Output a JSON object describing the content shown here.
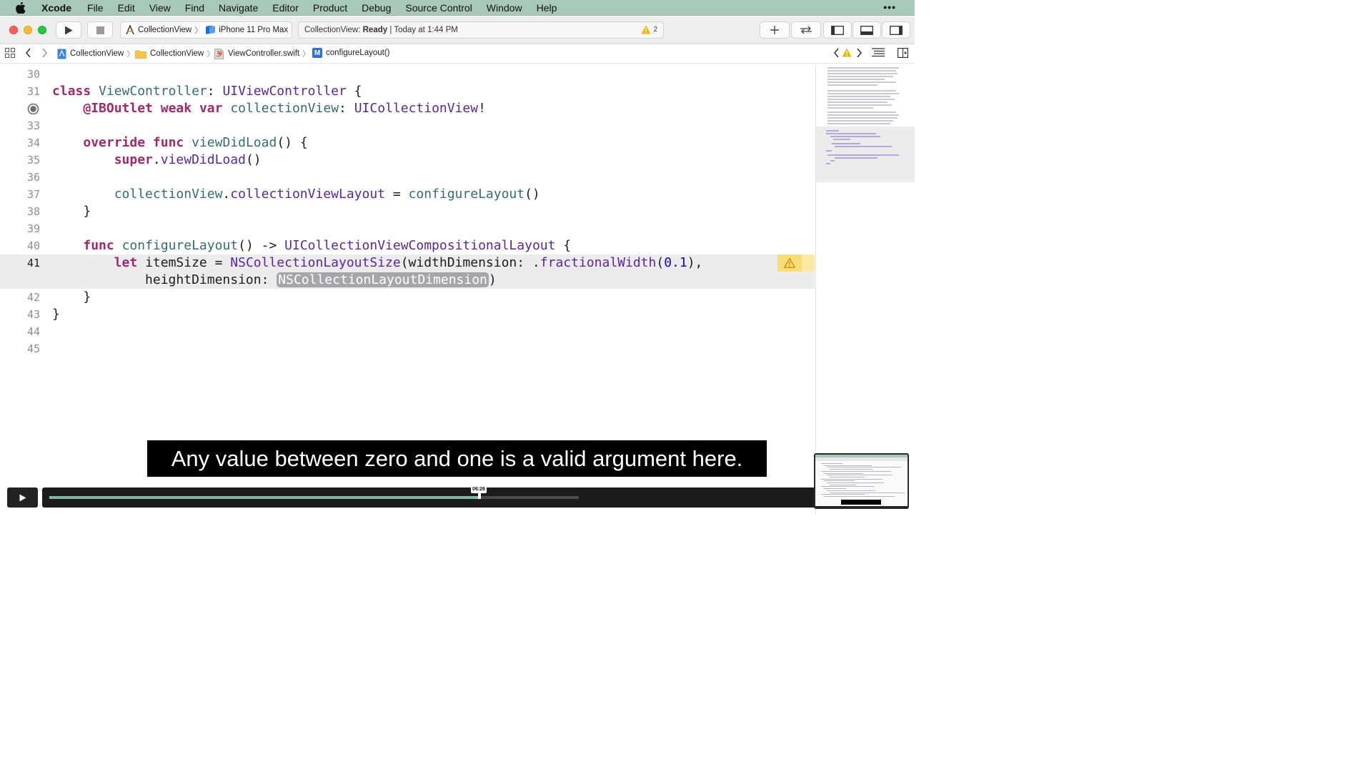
{
  "menubar": {
    "app": "Xcode",
    "items": [
      "File",
      "Edit",
      "View",
      "Find",
      "Navigate",
      "Editor",
      "Product",
      "Debug",
      "Source Control",
      "Window",
      "Help"
    ],
    "more": "•••"
  },
  "toolbar": {
    "scheme": "CollectionView",
    "device": "iPhone 11 Pro Max",
    "status_project": "CollectionView:",
    "status_state": "Ready",
    "status_time": "Today at 1:44 PM",
    "warning_count": "2",
    "warning_color": "#f5b400"
  },
  "jumpbar": {
    "items": [
      "CollectionView",
      "CollectionView",
      "ViewController.swift",
      "configureLayout()"
    ],
    "method_badge": "M"
  },
  "editor": {
    "line_numbers": [
      "30",
      "31",
      "33",
      "34",
      "35",
      "36",
      "37",
      "38",
      "39",
      "40",
      "41",
      "42",
      "43",
      "44",
      "45"
    ],
    "current_line": "41",
    "code": {
      "l31": {
        "kw": "class",
        "name": "ViewController",
        "colon": ": ",
        "super": "UIViewController",
        "brace": " {"
      },
      "l32": {
        "attr": "@IBOutlet",
        "weak": "weak",
        "var": "var",
        "name": "collectionView",
        "colon": ": ",
        "type": "UICollectionView",
        "bang": "!"
      },
      "l34": {
        "override": "override",
        "func": "func",
        "name": "viewDidLoad",
        "rest": "() {"
      },
      "l35": {
        "super": "super",
        "dot": ".",
        "call": "viewDidLoad",
        "rest": "()"
      },
      "l37": {
        "obj": "collectionView",
        "dot": ".",
        "prop": "collectionViewLayout",
        "eq": " = ",
        "call": "configureLayout",
        "rest": "()"
      },
      "l38": "}",
      "l40": {
        "func": "func",
        "name": "configureLayout",
        "arrow": "() -> ",
        "type": "UICollectionViewCompositionalLayout",
        "brace": " {"
      },
      "l41": {
        "let": "let",
        "name": "itemSize",
        "eq": " = ",
        "type": "NSCollectionLayoutSize",
        "arg1": "(widthDimension: .",
        "call": "fractionalWidth",
        "open": "(",
        "num": "0.1",
        "close": "),"
      },
      "l41b": {
        "label": "heightDimension: ",
        "placeholder": "NSCollectionLayoutDimension",
        "close": ")"
      },
      "l42": "}",
      "l43": "}"
    }
  },
  "caption": "Any value between zero and one is a valid argument here.",
  "player": {
    "time": "06:26",
    "progress": 0.81
  }
}
